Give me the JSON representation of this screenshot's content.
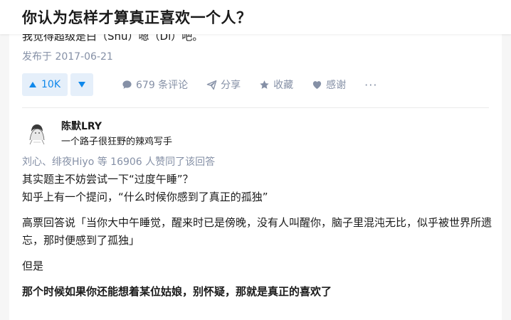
{
  "header": {
    "question_title": "你认为怎样才算真正喜欢一个人？"
  },
  "previous_answer": {
    "cut_off_text": "我觉得超级是白（Shu）嗯（Di）吧。",
    "publish_date": "发布于 2017-06-21",
    "actions": {
      "upvote_count": "10K",
      "comments_label": "679 条评论",
      "share_label": "分享",
      "collect_label": "收藏",
      "thanks_label": "感谢",
      "more_label": "···"
    }
  },
  "answer": {
    "author": {
      "name": "陈默LRY",
      "bio": "一个路子很狂野的辣鸡写手"
    },
    "voters_text": "刘心、绯夜Hiyo 等 16906 人赞同了该回答",
    "paragraphs": [
      "其实题主不妨尝试一下“过度午睡”？",
      "知乎上有一个提问，“什么时候你感到了真正的孤独”",
      "高票回答说「当你大中午睡觉，醒来时已是傍晚，没有人叫醒你，脑子里混沌无比，似乎被世界所遗忘，那时便感到了孤独」",
      "但是",
      "那个时候如果你还能想着某位姑娘，别怀疑，那就是真正的喜欢了"
    ]
  },
  "colors": {
    "accent_blue": "#0f88eb",
    "vote_bg": "#e5effa",
    "meta_gray": "#8590a6",
    "text": "#1a1a1a"
  }
}
